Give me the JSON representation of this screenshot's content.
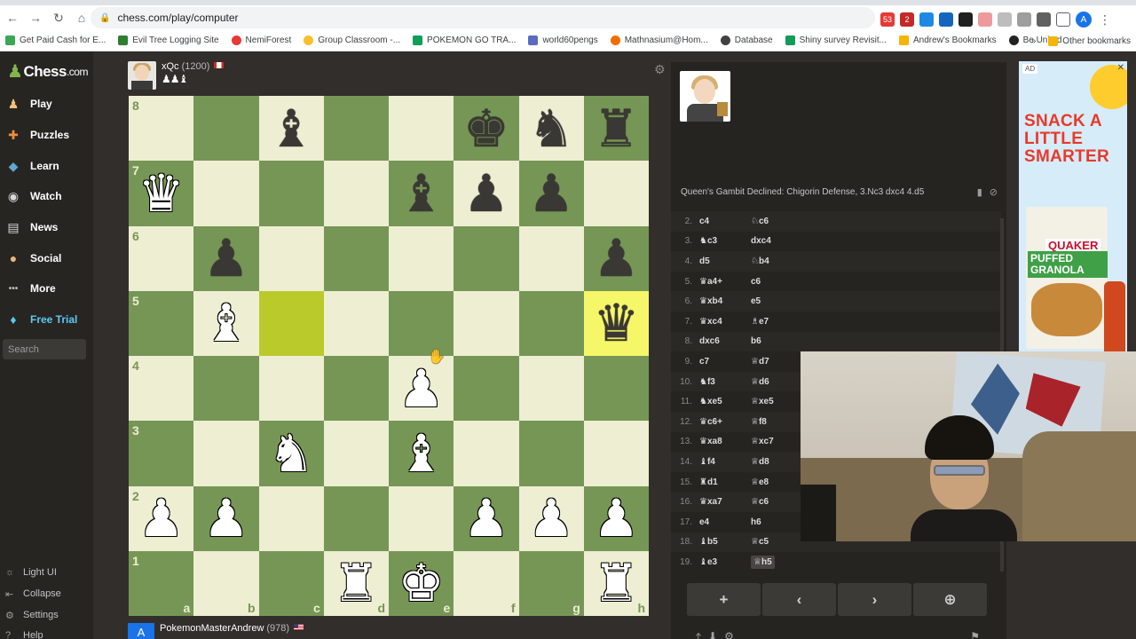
{
  "browser": {
    "url": "chess.com/play/computer",
    "profile_initial": "A",
    "extension_badges": [
      "53",
      "2"
    ],
    "bookmarks": [
      {
        "label": "Get Paid Cash for E...",
        "color": "#3aa757"
      },
      {
        "label": "Evil Tree Logging Site",
        "color": "#2e7d32"
      },
      {
        "label": "NemiForest",
        "color": "#e53935"
      },
      {
        "label": "Group Classroom -...",
        "color": "#fbc02d"
      },
      {
        "label": "POKEMON GO TRA...",
        "color": "#0f9d58"
      },
      {
        "label": "world60pengs",
        "color": "#5c6bc0"
      },
      {
        "label": "Mathnasium@Hom...",
        "color": "#ef6c00"
      },
      {
        "label": "Database",
        "color": "#424242"
      },
      {
        "label": "Shiny survey Revisit...",
        "color": "#0f9d58"
      },
      {
        "label": "Andrew's Bookmarks",
        "color": "#f4b400"
      },
      {
        "label": "Be United",
        "color": "#212121"
      }
    ],
    "other_bookmarks": "Other bookmarks",
    "bookmarks_overflow": "»"
  },
  "sidebar": {
    "logo_main": "Chess",
    "logo_suffix": ".com",
    "items": [
      {
        "label": "Play",
        "icon": "♟"
      },
      {
        "label": "Puzzles",
        "icon": "✚"
      },
      {
        "label": "Learn",
        "icon": "🎓"
      },
      {
        "label": "Watch",
        "icon": "◉"
      },
      {
        "label": "News",
        "icon": "▤"
      },
      {
        "label": "Social",
        "icon": "👤"
      },
      {
        "label": "More",
        "icon": "•••"
      },
      {
        "label": "Free Trial",
        "icon": "♦"
      }
    ],
    "search_placeholder": "Search",
    "bottom_items": [
      {
        "label": "Light UI",
        "icon": "☼"
      },
      {
        "label": "Collapse",
        "icon": "⇤"
      },
      {
        "label": "Settings",
        "icon": "⚙"
      },
      {
        "label": "Help",
        "icon": "?"
      }
    ]
  },
  "game": {
    "top_player": {
      "name": "xQc",
      "rating": "(1200)",
      "captured": "♟♟♝"
    },
    "bottom_player": {
      "name": "PokemonMasterAndrew",
      "rating": "(978)",
      "avatar_initial": "A"
    },
    "ranks": [
      "8",
      "7",
      "6",
      "5",
      "4",
      "3",
      "2",
      "1"
    ],
    "files": [
      "a",
      "b",
      "c",
      "d",
      "e",
      "f",
      "g",
      "h"
    ],
    "position": [
      [
        "",
        "",
        "b-b",
        "",
        "",
        "b-k",
        "b-n",
        "b-r"
      ],
      [
        "w-q",
        "",
        "",
        "",
        "b-b",
        "b-p",
        "b-p",
        ""
      ],
      [
        "",
        "b-p",
        "",
        "",
        "",
        "",
        "",
        "b-p"
      ],
      [
        "",
        "w-b",
        "",
        "",
        "",
        "",
        "",
        "b-q"
      ],
      [
        "",
        "",
        "",
        "",
        "w-p",
        "",
        "",
        ""
      ],
      [
        "",
        "",
        "w-n",
        "",
        "w-b",
        "",
        "",
        ""
      ],
      [
        "w-p",
        "w-p",
        "",
        "",
        "",
        "w-p",
        "w-p",
        "w-p"
      ],
      [
        "",
        "",
        "",
        "w-r",
        "w-k",
        "",
        "",
        "w-r"
      ]
    ],
    "highlight_squares": [
      "c5",
      "h5"
    ]
  },
  "panel": {
    "opening": "Queen's Gambit Declined: Chigorin Defense, 3.Nc3 dxc4 4.d5",
    "moves": [
      {
        "num": "2.",
        "white": "c4",
        "black": "♘c6"
      },
      {
        "num": "3.",
        "white": "♞c3",
        "black": "dxc4"
      },
      {
        "num": "4.",
        "white": "d5",
        "black": "♘b4"
      },
      {
        "num": "5.",
        "white": "♛a4+",
        "black": "c6"
      },
      {
        "num": "6.",
        "white": "♛xb4",
        "black": "e5"
      },
      {
        "num": "7.",
        "white": "♛xc4",
        "black": "♗e7"
      },
      {
        "num": "8.",
        "white": "dxc6",
        "black": "b6"
      },
      {
        "num": "9.",
        "white": "c7",
        "black": "♕d7"
      },
      {
        "num": "10.",
        "white": "♞f3",
        "black": "♕d6"
      },
      {
        "num": "11.",
        "white": "♞xe5",
        "black": "♕xe5"
      },
      {
        "num": "12.",
        "white": "♛c6+",
        "black": "♕f8"
      },
      {
        "num": "13.",
        "white": "♛xa8",
        "black": "♕xc7"
      },
      {
        "num": "14.",
        "white": "♝f4",
        "black": "♕d8"
      },
      {
        "num": "15.",
        "white": "♜d1",
        "black": "♕e8"
      },
      {
        "num": "16.",
        "white": "♛xa7",
        "black": "♕c6"
      },
      {
        "num": "17.",
        "white": "e4",
        "black": "h6"
      },
      {
        "num": "18.",
        "white": "♝b5",
        "black": "♕c5"
      },
      {
        "num": "19.",
        "white": "♝e3",
        "black": "♕h5"
      }
    ],
    "controls": [
      "+",
      "‹",
      "›",
      "⊕"
    ]
  },
  "ad": {
    "tag": "AD",
    "close": "✕",
    "headline": "SNACK A LITTLE SMARTER",
    "brand": "QUAKER",
    "product": "PUFFED GRANOLA"
  }
}
